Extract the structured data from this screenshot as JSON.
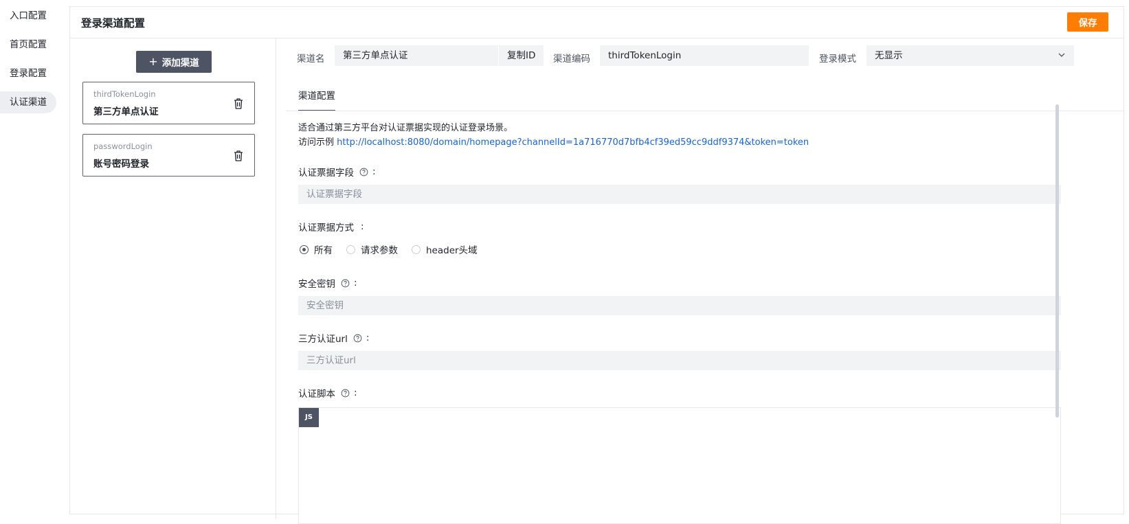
{
  "nav": {
    "items": [
      {
        "label": "入口配置"
      },
      {
        "label": "首页配置"
      },
      {
        "label": "登录配置"
      },
      {
        "label": "认证渠道"
      }
    ],
    "active_index": 3
  },
  "header": {
    "title": "登录渠道配置",
    "save_label": "保存"
  },
  "channels": {
    "add_label": "添加渠道",
    "items": [
      {
        "code": "thirdTokenLogin",
        "name": "第三方单点认证"
      },
      {
        "code": "passwordLogin",
        "name": "账号密码登录"
      }
    ]
  },
  "detail": {
    "channel_name_label": "渠道名",
    "channel_name_value": "第三方单点认证",
    "copy_id_label": "复制ID",
    "channel_code_label": "渠道编码",
    "channel_code_value": "thirdTokenLogin",
    "login_mode_label": "登录模式",
    "login_mode_value": "无显示",
    "tab_label": "渠道配置",
    "description": "适合通过第三方平台对认证票据实现的认证登录场景。",
    "example_prefix": "访问示例",
    "example_url": "http://localhost:8080/domain/homepage?channelId=1a716770d7bfb4cf39ed59cc9ddf9374&token=token",
    "colon": ":",
    "ticket_field": {
      "label": "认证票据字段",
      "placeholder": "认证票据字段"
    },
    "ticket_method": {
      "label": "认证票据方式",
      "options": [
        "所有",
        "请求参数",
        "header头域"
      ],
      "selected_index": 0
    },
    "secret_key": {
      "label": "安全密钥",
      "placeholder": "安全密钥"
    },
    "third_url": {
      "label": "三方认证url",
      "placeholder": "三方认证url"
    },
    "script": {
      "label": "认证脚本",
      "badge": "JS"
    }
  },
  "colors": {
    "accent": "#ff7d00",
    "dark": "#4e5463",
    "link": "#1664d6",
    "field_bg": "#f2f3f5"
  },
  "icons": {
    "trash": "trash-icon",
    "help": "question-circle-icon",
    "chevron": "chevron-down-icon",
    "plus": "plus-icon"
  }
}
